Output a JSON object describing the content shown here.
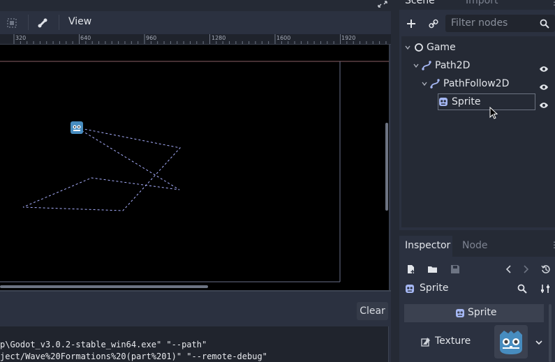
{
  "toolbar": {
    "view_label": "View"
  },
  "ruler": {
    "ticks": [
      "320",
      "640",
      "960",
      "1280",
      "1600",
      "1920"
    ]
  },
  "output": {
    "clear_label": "Clear",
    "lines": [
      "p\\Godot_v3.0.2-stable_win64.exe\" \"--path\"",
      "ject/Wave%20Formations%20(part%201)\" \"--remote-debug\""
    ]
  },
  "scene_dock": {
    "tabs": [
      "Scene",
      "Import"
    ],
    "filter_placeholder": "Filter nodes",
    "nodes": [
      {
        "name": "Game",
        "icon": "node-circle-icon"
      },
      {
        "name": "Path2D",
        "icon": "path2d-icon"
      },
      {
        "name": "PathFollow2D",
        "icon": "pathfollow2d-icon"
      },
      {
        "name": "Sprite",
        "icon": "sprite-icon"
      }
    ]
  },
  "inspector": {
    "tabs": [
      "Inspector",
      "Node"
    ],
    "object_name": "Sprite",
    "section_title": "Sprite",
    "property_label": "Texture"
  },
  "colors": {
    "accent": "#6c8fd4",
    "panel_bg": "#2b3140",
    "dark_bg": "#252a35",
    "path_line": "#a9b0ff"
  }
}
